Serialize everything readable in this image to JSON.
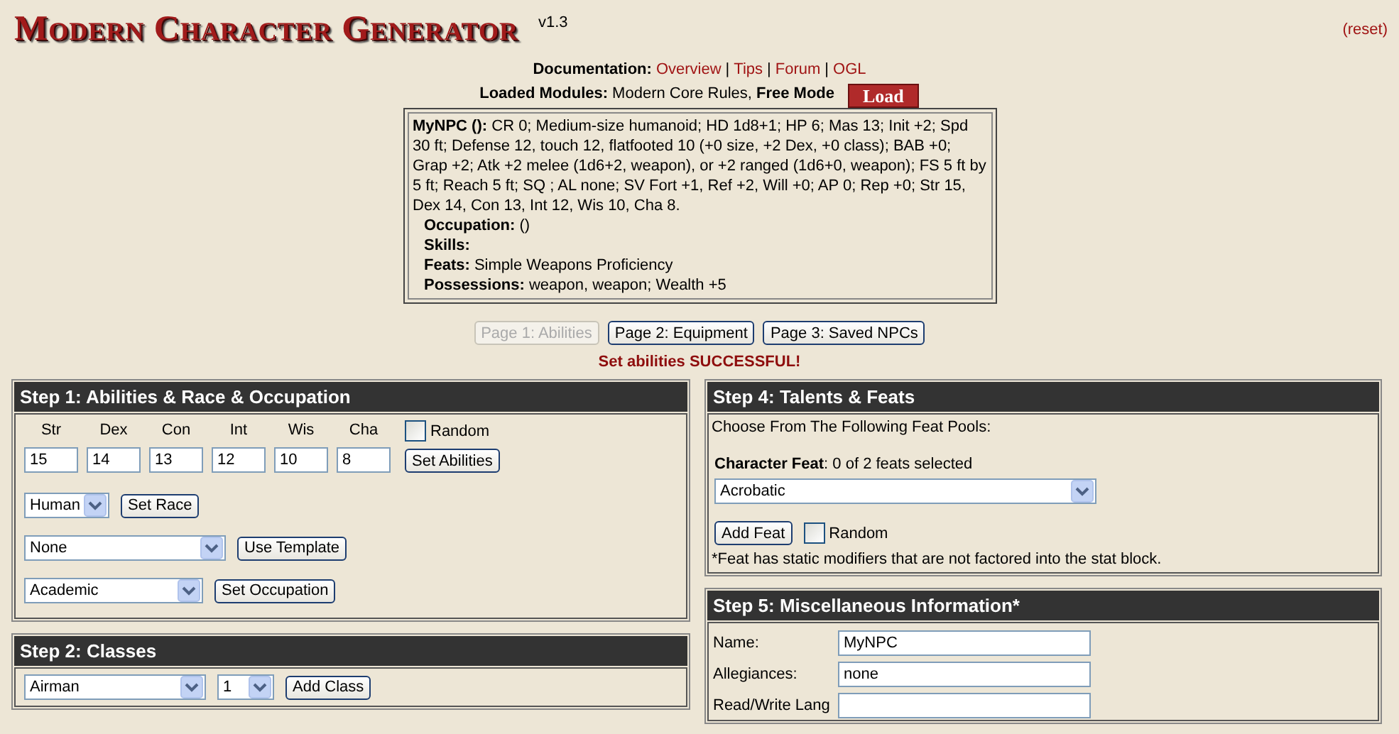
{
  "header": {
    "title": "Modern Character Generator",
    "version": "v1.3",
    "reset": "(reset)"
  },
  "documentation": {
    "label": "Documentation:",
    "links": [
      "Overview",
      "Tips",
      "Forum",
      "OGL"
    ],
    "separator": "|"
  },
  "modules": {
    "label": "Loaded Modules:",
    "text": "Modern Core Rules,",
    "mode": "Free Mode",
    "load_button": "Load"
  },
  "stat_block": {
    "name": "MyNPC ():",
    "summary": "CR 0; Medium-size humanoid; HD 1d8+1; HP 6; Mas 13; Init +2; Spd 30 ft; Defense 12, touch 12, flatfooted 10 (+0 size, +2 Dex, +0 class); BAB +0; Grap +2; Atk +2 melee (1d6+2, weapon), or +2 ranged (1d6+0, weapon); FS 5 ft by 5 ft; Reach 5 ft; SQ ; AL none; SV Fort +1, Ref +2, Will +0; AP 0; Rep +0; Str 15, Dex 14, Con 13, Int 12, Wis 10, Cha 8.",
    "lines": [
      {
        "label": "Occupation:",
        "text": "()"
      },
      {
        "label": "Skills:"
      },
      {
        "label": "Feats:",
        "text": "Simple Weapons Proficiency"
      },
      {
        "label": "Possessions:",
        "text": "weapon, weapon; Wealth +5"
      }
    ]
  },
  "pages": [
    {
      "label": "Page 1: Abilities",
      "disabled": true
    },
    {
      "label": "Page 2: Equipment",
      "disabled": false
    },
    {
      "label": "Page 3: Saved NPCs",
      "disabled": false
    }
  ],
  "message": "Set abilities SUCCESSFUL!",
  "step1": {
    "title": "Step 1: Abilities & Race & Occupation",
    "abilities": [
      {
        "label": "Str",
        "value": "15"
      },
      {
        "label": "Dex",
        "value": "14"
      },
      {
        "label": "Con",
        "value": "13"
      },
      {
        "label": "Int",
        "value": "12"
      },
      {
        "label": "Wis",
        "value": "10"
      },
      {
        "label": "Cha",
        "value": "8"
      }
    ],
    "random": {
      "label": "Random",
      "checked": false
    },
    "set_button": "Set Abilities",
    "rows": [
      {
        "select": "Human",
        "button": "Set Race"
      },
      {
        "select": "None",
        "button": "Use Template"
      },
      {
        "select": "Academic",
        "button": "Set Occupation"
      }
    ]
  },
  "step2": {
    "title": "Step 2: Classes",
    "class_select": "Airman",
    "level_select": "1",
    "button": "Add Class"
  },
  "step4": {
    "title": "Step 4: Talents & Feats",
    "intro": "Choose From The Following Feat Pools:",
    "feat_label": "Character Feat",
    "feat_count": ": 0 of 2 feats selected",
    "select": "Acrobatic",
    "add_button": "Add Feat",
    "random": {
      "label": "Random",
      "checked": false
    },
    "note": "*Feat has static modifiers that are not factored into the stat block."
  },
  "step5": {
    "title": "Step 5: Miscellaneous Information*",
    "fields": [
      {
        "label": "Name:",
        "value": "MyNPC"
      },
      {
        "label": "Allegiances:",
        "value": "none"
      },
      {
        "label": "Read/Write Lang"
      }
    ]
  }
}
